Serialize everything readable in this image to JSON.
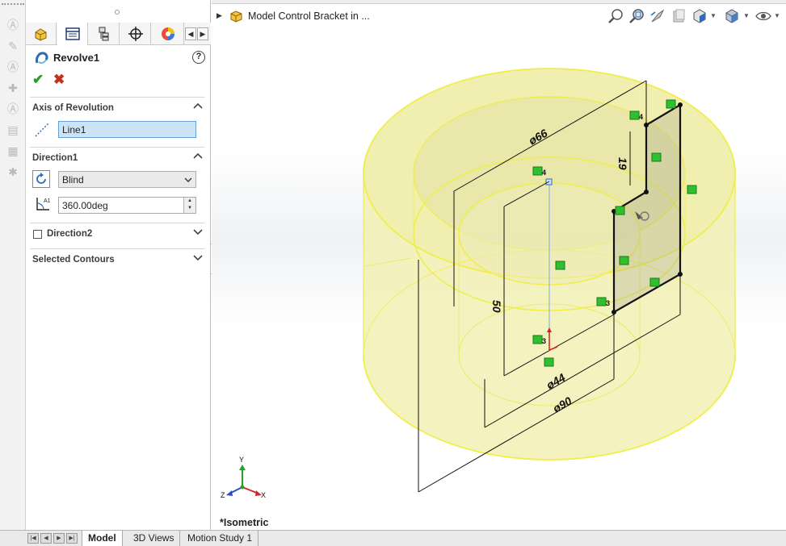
{
  "tree": {
    "part_title": "Model Control Bracket in ..."
  },
  "feature": {
    "title": "Revolve1",
    "help_label": "?"
  },
  "axis_section": {
    "title": "Axis of Revolution",
    "value": "Line1"
  },
  "direction1": {
    "title": "Direction1",
    "type_value": "Blind",
    "angle_value": "360.00deg"
  },
  "direction2": {
    "title": "Direction2"
  },
  "contours": {
    "title": "Selected Contours"
  },
  "viewport": {
    "view_name": "*Isometric",
    "dims": {
      "d66": "ø66",
      "d19": "19",
      "d50": "50",
      "d44": "ø44",
      "d90": "ø90"
    },
    "constraint_marks": {
      "top1": "4",
      "top2": "4",
      "mid": "3",
      "bot": "3"
    },
    "triad": {
      "x": "X",
      "y": "Y",
      "z": "Z"
    }
  },
  "bottom_tabs": [
    {
      "label": "Model"
    },
    {
      "label": "3D Views"
    },
    {
      "label": "Motion Study 1"
    }
  ],
  "colors": {
    "accent": "#2d9b2d",
    "cancel": "#c0321e",
    "solid_fill": "#f2f0b4",
    "edge": "#f0ee4a",
    "selected_field": "#cde4f7"
  },
  "icons": {
    "tabs": [
      "feature-manager-icon",
      "property-manager-icon",
      "configuration-manager-icon",
      "dimxpert-icon",
      "display-manager-icon"
    ],
    "heads_up": [
      "zoom-to-fit-icon",
      "zoom-area-icon",
      "previous-view-icon",
      "section-view-icon",
      "view-orientation-icon",
      "display-style-icon",
      "hide-show-icon"
    ]
  }
}
